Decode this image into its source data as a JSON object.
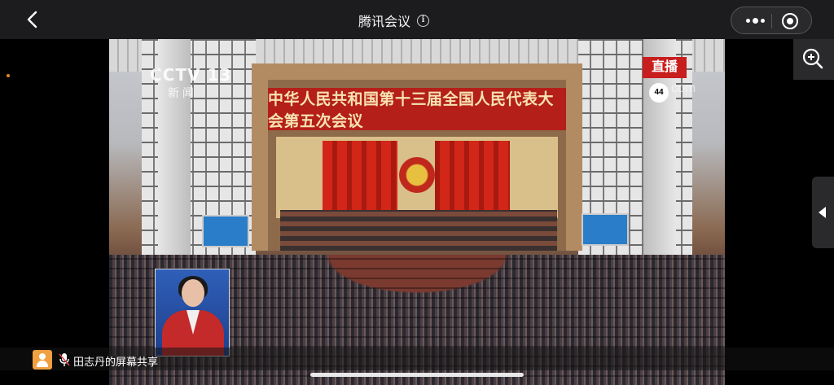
{
  "header": {
    "title": "腾讯会议",
    "back_icon": "chevron-left-icon",
    "info_icon": "info-icon",
    "more_icon": "more-dots-icon",
    "record_icon": "target-icon"
  },
  "video": {
    "channel_logo": "CCTV 13",
    "channel_sub": "新 闻",
    "live_badge": "直播",
    "temperature": "44",
    "watermark": "com",
    "banner_text": "中华人民共和国第十三届全国人民代表大会第五次会议"
  },
  "share": {
    "label": "田志丹的屏幕共享",
    "avatar_icon": "user-avatar-icon",
    "mic_icon": "mic-muted-icon"
  },
  "side": {
    "zoom_icon": "zoom-in-icon",
    "collapse_icon": "chevron-left-icon"
  },
  "colors": {
    "topbar": "#1c1c1e",
    "live_red": "#c81e1e",
    "banner_red": "#b41f1a",
    "avatar_orange": "#f0a040"
  }
}
